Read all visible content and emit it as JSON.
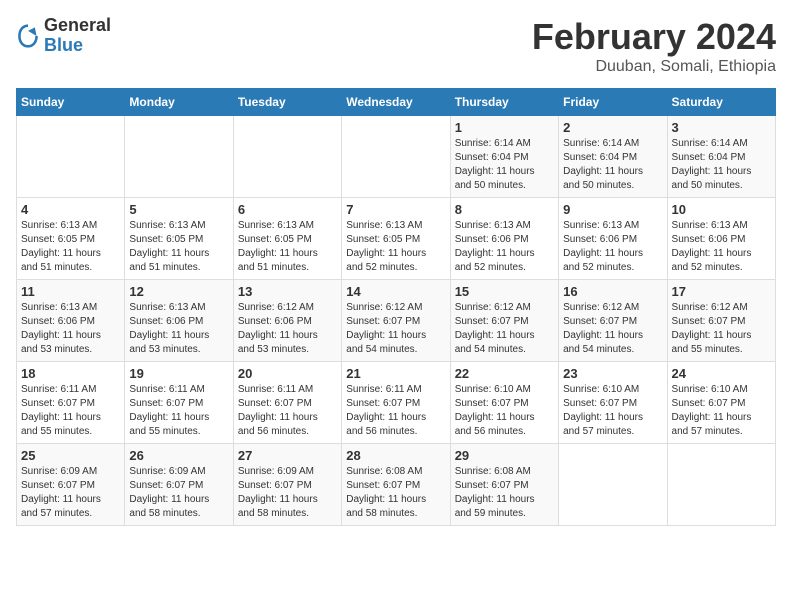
{
  "logo": {
    "general": "General",
    "blue": "Blue"
  },
  "header": {
    "title": "February 2024",
    "subtitle": "Duuban, Somali, Ethiopia"
  },
  "days_of_week": [
    "Sunday",
    "Monday",
    "Tuesday",
    "Wednesday",
    "Thursday",
    "Friday",
    "Saturday"
  ],
  "weeks": [
    [
      {
        "day": "",
        "info": ""
      },
      {
        "day": "",
        "info": ""
      },
      {
        "day": "",
        "info": ""
      },
      {
        "day": "",
        "info": ""
      },
      {
        "day": "1",
        "info": "Sunrise: 6:14 AM\nSunset: 6:04 PM\nDaylight: 11 hours\nand 50 minutes."
      },
      {
        "day": "2",
        "info": "Sunrise: 6:14 AM\nSunset: 6:04 PM\nDaylight: 11 hours\nand 50 minutes."
      },
      {
        "day": "3",
        "info": "Sunrise: 6:14 AM\nSunset: 6:04 PM\nDaylight: 11 hours\nand 50 minutes."
      }
    ],
    [
      {
        "day": "4",
        "info": "Sunrise: 6:13 AM\nSunset: 6:05 PM\nDaylight: 11 hours\nand 51 minutes."
      },
      {
        "day": "5",
        "info": "Sunrise: 6:13 AM\nSunset: 6:05 PM\nDaylight: 11 hours\nand 51 minutes."
      },
      {
        "day": "6",
        "info": "Sunrise: 6:13 AM\nSunset: 6:05 PM\nDaylight: 11 hours\nand 51 minutes."
      },
      {
        "day": "7",
        "info": "Sunrise: 6:13 AM\nSunset: 6:05 PM\nDaylight: 11 hours\nand 52 minutes."
      },
      {
        "day": "8",
        "info": "Sunrise: 6:13 AM\nSunset: 6:06 PM\nDaylight: 11 hours\nand 52 minutes."
      },
      {
        "day": "9",
        "info": "Sunrise: 6:13 AM\nSunset: 6:06 PM\nDaylight: 11 hours\nand 52 minutes."
      },
      {
        "day": "10",
        "info": "Sunrise: 6:13 AM\nSunset: 6:06 PM\nDaylight: 11 hours\nand 52 minutes."
      }
    ],
    [
      {
        "day": "11",
        "info": "Sunrise: 6:13 AM\nSunset: 6:06 PM\nDaylight: 11 hours\nand 53 minutes."
      },
      {
        "day": "12",
        "info": "Sunrise: 6:13 AM\nSunset: 6:06 PM\nDaylight: 11 hours\nand 53 minutes."
      },
      {
        "day": "13",
        "info": "Sunrise: 6:12 AM\nSunset: 6:06 PM\nDaylight: 11 hours\nand 53 minutes."
      },
      {
        "day": "14",
        "info": "Sunrise: 6:12 AM\nSunset: 6:07 PM\nDaylight: 11 hours\nand 54 minutes."
      },
      {
        "day": "15",
        "info": "Sunrise: 6:12 AM\nSunset: 6:07 PM\nDaylight: 11 hours\nand 54 minutes."
      },
      {
        "day": "16",
        "info": "Sunrise: 6:12 AM\nSunset: 6:07 PM\nDaylight: 11 hours\nand 54 minutes."
      },
      {
        "day": "17",
        "info": "Sunrise: 6:12 AM\nSunset: 6:07 PM\nDaylight: 11 hours\nand 55 minutes."
      }
    ],
    [
      {
        "day": "18",
        "info": "Sunrise: 6:11 AM\nSunset: 6:07 PM\nDaylight: 11 hours\nand 55 minutes."
      },
      {
        "day": "19",
        "info": "Sunrise: 6:11 AM\nSunset: 6:07 PM\nDaylight: 11 hours\nand 55 minutes."
      },
      {
        "day": "20",
        "info": "Sunrise: 6:11 AM\nSunset: 6:07 PM\nDaylight: 11 hours\nand 56 minutes."
      },
      {
        "day": "21",
        "info": "Sunrise: 6:11 AM\nSunset: 6:07 PM\nDaylight: 11 hours\nand 56 minutes."
      },
      {
        "day": "22",
        "info": "Sunrise: 6:10 AM\nSunset: 6:07 PM\nDaylight: 11 hours\nand 56 minutes."
      },
      {
        "day": "23",
        "info": "Sunrise: 6:10 AM\nSunset: 6:07 PM\nDaylight: 11 hours\nand 57 minutes."
      },
      {
        "day": "24",
        "info": "Sunrise: 6:10 AM\nSunset: 6:07 PM\nDaylight: 11 hours\nand 57 minutes."
      }
    ],
    [
      {
        "day": "25",
        "info": "Sunrise: 6:09 AM\nSunset: 6:07 PM\nDaylight: 11 hours\nand 57 minutes."
      },
      {
        "day": "26",
        "info": "Sunrise: 6:09 AM\nSunset: 6:07 PM\nDaylight: 11 hours\nand 58 minutes."
      },
      {
        "day": "27",
        "info": "Sunrise: 6:09 AM\nSunset: 6:07 PM\nDaylight: 11 hours\nand 58 minutes."
      },
      {
        "day": "28",
        "info": "Sunrise: 6:08 AM\nSunset: 6:07 PM\nDaylight: 11 hours\nand 58 minutes."
      },
      {
        "day": "29",
        "info": "Sunrise: 6:08 AM\nSunset: 6:07 PM\nDaylight: 11 hours\nand 59 minutes."
      },
      {
        "day": "",
        "info": ""
      },
      {
        "day": "",
        "info": ""
      }
    ]
  ]
}
